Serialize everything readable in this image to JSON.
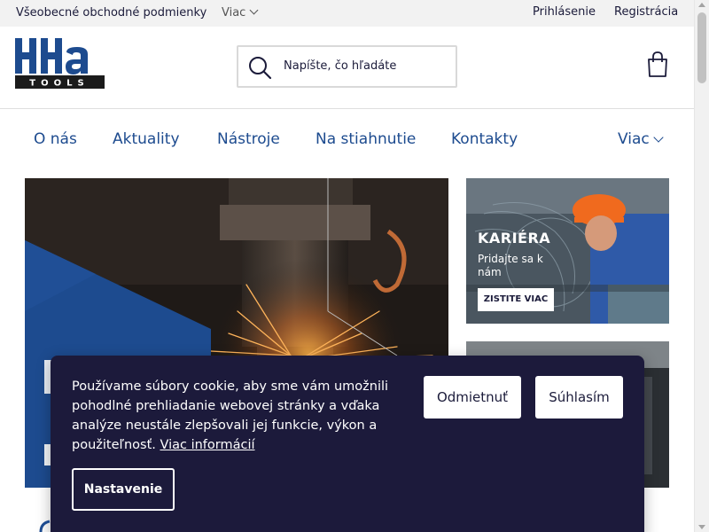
{
  "topbar": {
    "terms": "Všeobecné obchodné podmienky",
    "more": "Viac",
    "login": "Prihlásenie",
    "register": "Registrácia"
  },
  "logo": {
    "text": "HHa",
    "subtext": "TOOLS"
  },
  "search": {
    "placeholder": "Napíšte, čo hľadáte"
  },
  "nav": {
    "items": [
      {
        "label": "O nás"
      },
      {
        "label": "Aktuality"
      },
      {
        "label": "Nástroje"
      },
      {
        "label": "Na stiahnutie"
      },
      {
        "label": "Kontakty"
      }
    ],
    "more": "Viac"
  },
  "career_card": {
    "title": "KARIÉRA",
    "subtitle": "Pridajte sa k nám",
    "button": "ZISTITE VIAC"
  },
  "cookie": {
    "text": "Používame súbory cookie, aby sme vám umožnili pohodlné prehliadanie webovej stránky a vďaka analýze neustále zlepšovali jej funkcie, výkon a použiteľnosť.",
    "link": "Viac informácií",
    "decline": "Odmietnuť",
    "accept": "Súhlasím",
    "settings": "Nastavenie"
  },
  "colors": {
    "brand_blue": "#1d4b8f",
    "dark_navy": "#1c1a3b",
    "topbar_bg": "#f2f2f2"
  }
}
